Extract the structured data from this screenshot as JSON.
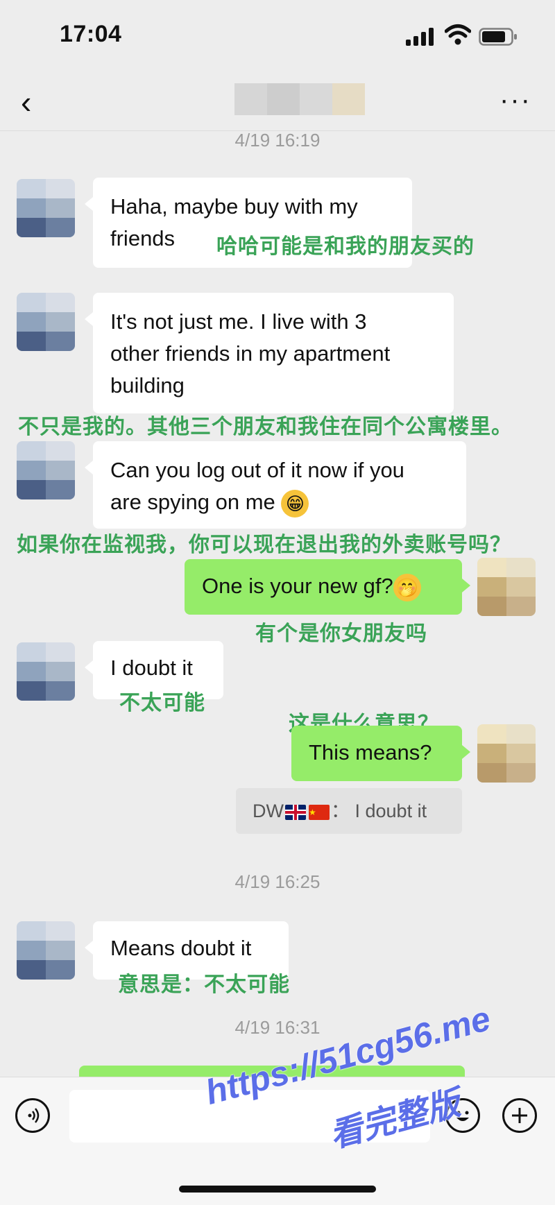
{
  "status_bar": {
    "time": "17:04"
  },
  "nav": {
    "back_glyph": "‹",
    "more_glyph": "···"
  },
  "timestamps": [
    "4/19 16:19",
    "4/19 16:25",
    "4/19 16:31"
  ],
  "messages": [
    {
      "side": "left",
      "lines": [
        "Haha, maybe buy with my",
        "friends"
      ],
      "annotation": "哈哈可能是和我的朋友买的"
    },
    {
      "side": "left",
      "lines": [
        "It's not just me. I live with 3",
        "other friends in my apartment",
        "building"
      ],
      "annotation": "不只是我的。其他三个朋友和我住在同个公寓楼里。"
    },
    {
      "side": "left",
      "lines": [
        "Can you log out of it now if you",
        "are spying on me"
      ],
      "emoji": "grinning-face",
      "emoji_glyph": "😁",
      "annotation": "如果你在监视我，你可以现在退出我的外卖账号吗？"
    },
    {
      "side": "right",
      "text": "One is your new gf?",
      "emoji": "thinking-face",
      "emoji_glyph": "🤭",
      "annotation": "有个是你女朋友吗"
    },
    {
      "side": "left",
      "text": "I doubt it",
      "annotation": "不太可能"
    },
    {
      "side": "right",
      "text": "This means?",
      "annotation": "这是什么意思？"
    },
    {
      "side": "left",
      "text": "Means doubt it",
      "annotation": "意思是：不太可能"
    }
  ],
  "translation_card": {
    "sender": "DW",
    "separator": "：",
    "text": "I doubt it"
  },
  "watermark": {
    "url": "https://51cg56.me",
    "subtitle": "看完整版"
  },
  "colors": {
    "bubble_self": "#95ec69",
    "bubble_other": "#ffffff",
    "annotation": "#3aa357",
    "watermark": "#5b6ee8",
    "background": "#ededed"
  },
  "input_bar": {
    "voice_icon": "voice-icon",
    "emoji_icon": "emoji-icon",
    "plus_icon": "plus-icon"
  }
}
